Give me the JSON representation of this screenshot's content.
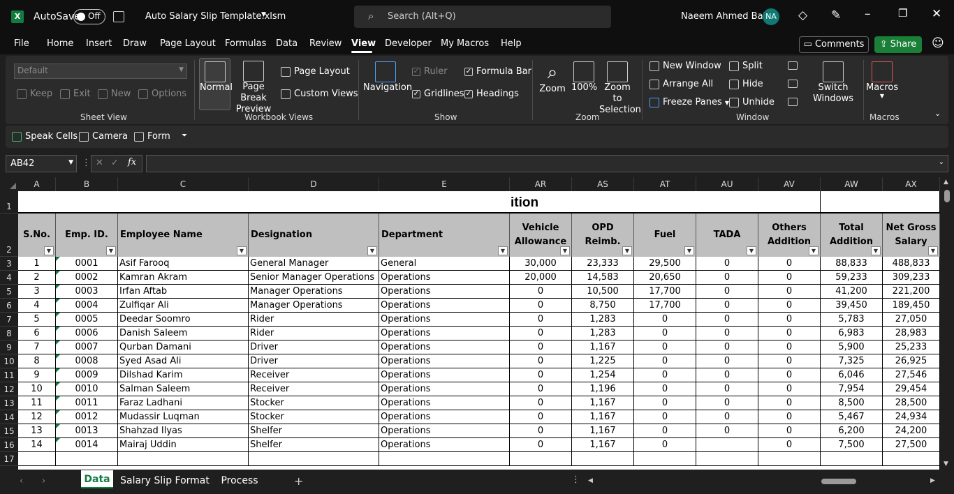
{
  "titlebar": {
    "autosave": "AutoSave",
    "toggle": "Off",
    "file_name": "Auto Salary Slip Template.xlsm",
    "search_placeholder": "Search (Alt+Q)",
    "user_name": "Naeem Ahmed Baig",
    "user_initials": "NA"
  },
  "menu": {
    "items": [
      "File",
      "Home",
      "Insert",
      "Draw",
      "Page Layout",
      "Formulas",
      "Data",
      "Review",
      "View",
      "Developer",
      "My Macros",
      "Help"
    ],
    "active": "View",
    "comments": "Comments",
    "share": "Share"
  },
  "ribbon": {
    "sheet_view": {
      "dropdown": "Default",
      "keep": "Keep",
      "exit": "Exit",
      "new": "New",
      "options": "Options",
      "group": "Sheet View"
    },
    "workbook_views": {
      "normal": "Normal",
      "page_break": "Page Break Preview",
      "page_layout": "Page Layout",
      "custom_views": "Custom Views",
      "group": "Workbook Views"
    },
    "show": {
      "navigation": "Navigation",
      "ruler": "Ruler",
      "formula_bar": "Formula Bar",
      "gridlines": "Gridlines",
      "headings": "Headings",
      "group": "Show"
    },
    "zoom": {
      "zoom": "Zoom",
      "hundred": "100%",
      "zoom_sel": "Zoom to Selection",
      "group": "Zoom"
    },
    "window": {
      "new_window": "New Window",
      "arrange_all": "Arrange All",
      "freeze_panes": "Freeze Panes",
      "split": "Split",
      "hide": "Hide",
      "unhide": "Unhide",
      "switch": "Switch Windows",
      "group": "Window"
    },
    "macros": {
      "macros": "Macros",
      "group": "Macros"
    }
  },
  "qat": {
    "speak": "Speak Cells",
    "camera": "Camera",
    "form": "Form"
  },
  "formula_bar": {
    "name_box": "AB42",
    "fx": "fx",
    "value": ""
  },
  "columns": [
    "A",
    "B",
    "C",
    "D",
    "E",
    "AR",
    "AS",
    "AT",
    "AU",
    "AV",
    "AW",
    "AX"
  ],
  "title_fragment": "ition",
  "headers": [
    "S.No.",
    "Emp. ID.",
    "Employee Name",
    "Designation",
    "Department",
    "Vehicle Allowance",
    "OPD Reimb.",
    "Fuel",
    "TADA",
    "Others Addition",
    "Total Addition",
    "Net Gross Salary"
  ],
  "rows": [
    [
      "1",
      "0001",
      "Asif Farooq",
      "General Manager",
      "General",
      "30,000",
      "23,333",
      "29,500",
      "0",
      "0",
      "88,833",
      "488,833"
    ],
    [
      "2",
      "0002",
      "Kamran Akram",
      "Senior Manager Operations",
      "Operations",
      "20,000",
      "14,583",
      "20,650",
      "0",
      "0",
      "59,233",
      "309,233"
    ],
    [
      "3",
      "0003",
      "Irfan Aftab",
      "Manager Operations",
      "Operations",
      "0",
      "10,500",
      "17,700",
      "0",
      "0",
      "41,200",
      "221,200"
    ],
    [
      "4",
      "0004",
      "Zulfiqar Ali",
      "Manager Operations",
      "Operations",
      "0",
      "8,750",
      "17,700",
      "0",
      "0",
      "39,450",
      "189,450"
    ],
    [
      "5",
      "0005",
      "Deedar Soomro",
      "Rider",
      "Operations",
      "0",
      "1,283",
      "0",
      "0",
      "0",
      "5,783",
      "27,050"
    ],
    [
      "6",
      "0006",
      "Danish Saleem",
      "Rider",
      "Operations",
      "0",
      "1,283",
      "0",
      "0",
      "0",
      "6,983",
      "28,983"
    ],
    [
      "7",
      "0007",
      "Qurban Damani",
      "Driver",
      "Operations",
      "0",
      "1,167",
      "0",
      "0",
      "0",
      "5,900",
      "25,233"
    ],
    [
      "8",
      "0008",
      "Syed Asad Ali",
      "Driver",
      "Operations",
      "0",
      "1,225",
      "0",
      "0",
      "0",
      "7,325",
      "26,925"
    ],
    [
      "9",
      "0009",
      "Dilshad Karim",
      "Receiver",
      "Operations",
      "0",
      "1,254",
      "0",
      "0",
      "0",
      "6,046",
      "27,546"
    ],
    [
      "10",
      "0010",
      "Salman Saleem",
      "Receiver",
      "Operations",
      "0",
      "1,196",
      "0",
      "0",
      "0",
      "7,954",
      "29,454"
    ],
    [
      "11",
      "0011",
      "Faraz Ladhani",
      "Stocker",
      "Operations",
      "0",
      "1,167",
      "0",
      "0",
      "0",
      "8,500",
      "28,500"
    ],
    [
      "12",
      "0012",
      "Mudassir Luqman",
      "Stocker",
      "Operations",
      "0",
      "1,167",
      "0",
      "0",
      "0",
      "5,467",
      "24,934"
    ],
    [
      "13",
      "0013",
      "Shahzad Ilyas",
      "Shelfer",
      "Operations",
      "0",
      "1,167",
      "0",
      "0",
      "0",
      "6,200",
      "24,200"
    ],
    [
      "14",
      "0014",
      "Mairaj Uddin",
      "Shelfer",
      "Operations",
      "0",
      "1,167",
      "0",
      "",
      "0",
      "7,500",
      "27,500"
    ]
  ],
  "row_numbers": [
    "1",
    "2",
    "3",
    "4",
    "5",
    "6",
    "7",
    "8",
    "9",
    "10",
    "11",
    "12",
    "13",
    "14",
    "15",
    "16",
    "17"
  ],
  "sheets": {
    "tabs": [
      "Data",
      "Salary Slip Format",
      "Process"
    ],
    "active": "Data"
  }
}
